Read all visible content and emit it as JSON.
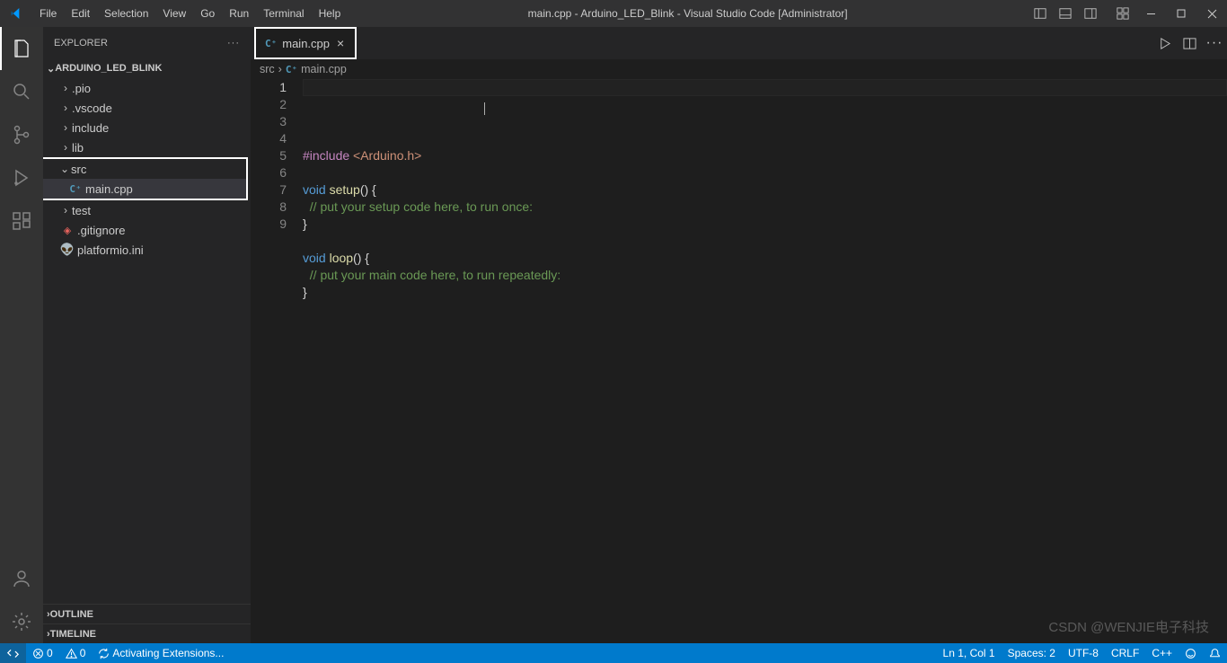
{
  "title": "main.cpp - Arduino_LED_Blink - Visual Studio Code [Administrator]",
  "menu": [
    "File",
    "Edit",
    "Selection",
    "View",
    "Go",
    "Run",
    "Terminal",
    "Help"
  ],
  "explorer": {
    "label": "EXPLORER",
    "project": "ARDUINO_LED_BLINK",
    "tree": [
      {
        "indent": 1,
        "type": "folder",
        "label": ".pio"
      },
      {
        "indent": 1,
        "type": "folder",
        "label": ".vscode"
      },
      {
        "indent": 1,
        "type": "folder",
        "label": "include"
      },
      {
        "indent": 1,
        "type": "folder",
        "label": "lib"
      },
      {
        "indent": 1,
        "type": "folder",
        "label": "src",
        "open": true,
        "hl": true
      },
      {
        "indent": 2,
        "type": "cpp",
        "label": "main.cpp",
        "sel": true,
        "hl": true
      },
      {
        "indent": 1,
        "type": "folder",
        "label": "test"
      },
      {
        "indent": 1,
        "type": "git",
        "label": ".gitignore"
      },
      {
        "indent": 1,
        "type": "pio",
        "label": "platformio.ini"
      }
    ],
    "panels": [
      "OUTLINE",
      "TIMELINE"
    ]
  },
  "tab": {
    "label": "main.cpp"
  },
  "crumbs": {
    "a": "src",
    "b": "main.cpp"
  },
  "code": {
    "lines": [
      {
        "n": 1,
        "parts": [
          {
            "c": "tk-kw",
            "t": "#include"
          },
          {
            "t": " "
          },
          {
            "c": "tk-str",
            "t": "<Arduino.h>"
          }
        ],
        "cur": true
      },
      {
        "n": 2,
        "parts": []
      },
      {
        "n": 3,
        "parts": [
          {
            "c": "tk-bl",
            "t": "void"
          },
          {
            "t": " "
          },
          {
            "c": "tk-func",
            "t": "setup"
          },
          {
            "c": "tk-pun",
            "t": "() {"
          }
        ]
      },
      {
        "n": 4,
        "parts": [
          {
            "t": "  "
          },
          {
            "c": "tk-cmt",
            "t": "// put your setup code here, to run once:"
          }
        ]
      },
      {
        "n": 5,
        "parts": [
          {
            "c": "tk-pun",
            "t": "}"
          }
        ]
      },
      {
        "n": 6,
        "parts": []
      },
      {
        "n": 7,
        "parts": [
          {
            "c": "tk-bl",
            "t": "void"
          },
          {
            "t": " "
          },
          {
            "c": "tk-func",
            "t": "loop"
          },
          {
            "c": "tk-pun",
            "t": "() {"
          }
        ]
      },
      {
        "n": 8,
        "parts": [
          {
            "t": "  "
          },
          {
            "c": "tk-cmt",
            "t": "// put your main code here, to run repeatedly:"
          }
        ]
      },
      {
        "n": 9,
        "parts": [
          {
            "c": "tk-pun",
            "t": "}"
          }
        ]
      }
    ]
  },
  "status": {
    "errors": "0",
    "warnings": "0",
    "activating": "Activating Extensions...",
    "pos": "Ln 1, Col 1",
    "spaces": "Spaces: 2",
    "enc": "UTF-8",
    "eol": "CRLF",
    "lang": "C++"
  },
  "watermark": "CSDN @WENJIE电子科技"
}
